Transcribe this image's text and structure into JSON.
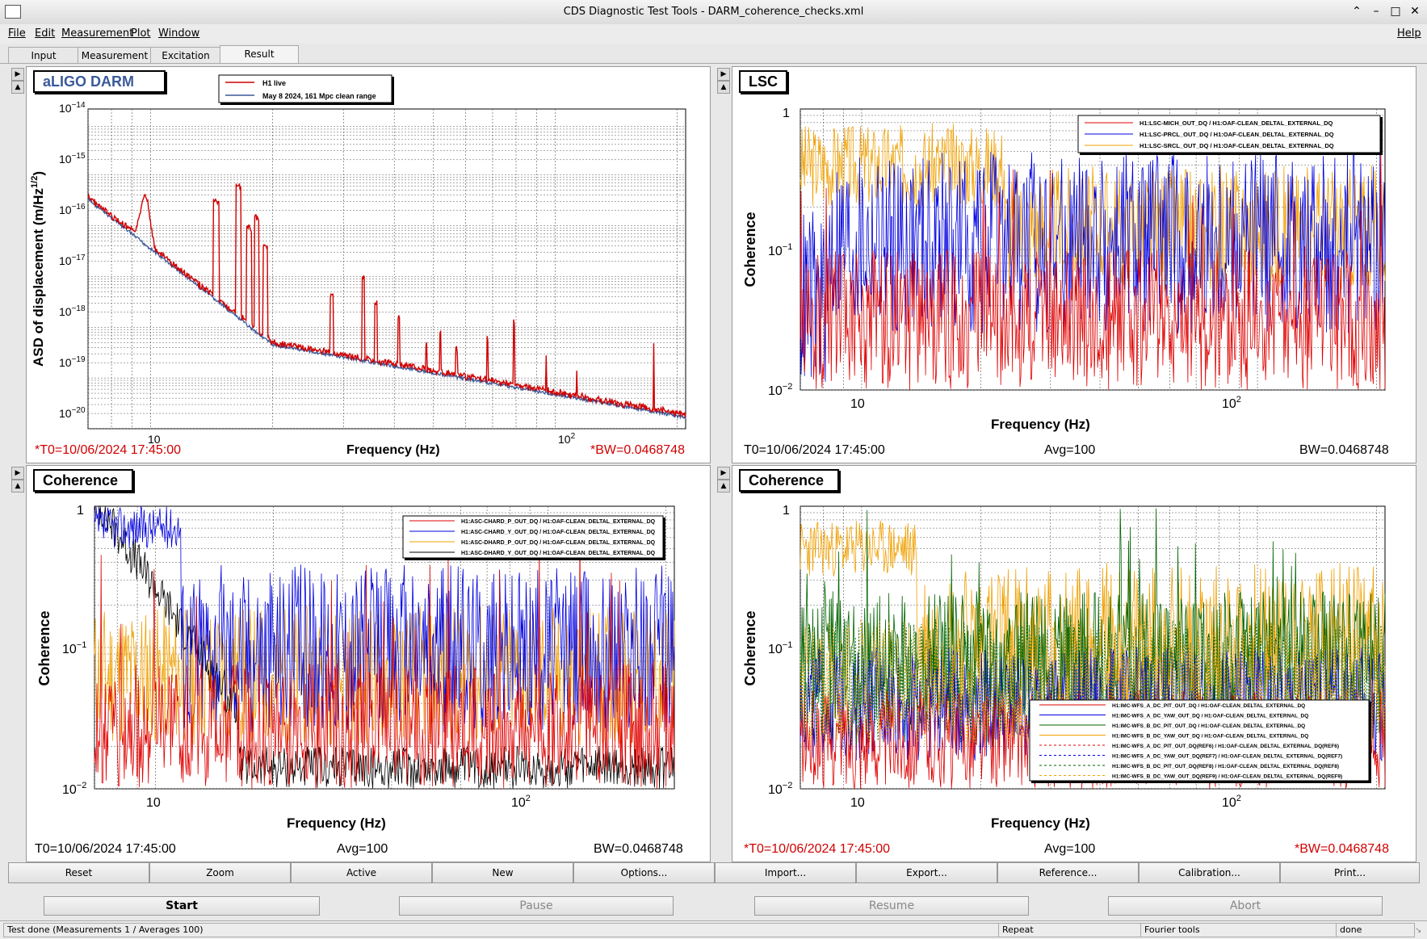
{
  "window": {
    "title": "CDS Diagnostic Test Tools - DARM_coherence_checks.xml"
  },
  "menu": {
    "file": "File",
    "edit": "Edit",
    "measurement": "Measurement",
    "plot": "Plot",
    "window": "Window",
    "help": "Help"
  },
  "tabs": [
    "Input",
    "Measurement",
    "Excitation",
    "Result"
  ],
  "active_tab": "Result",
  "panels": {
    "darm": {
      "label": "aLIGO DARM",
      "t0": "*T0=10/06/2024 17:45:00",
      "bw": "*BW=0.0468748",
      "xlabel": "Frequency (Hz)",
      "ylabel": "ASD of displacement (m/Hz",
      "ylabel_sup": "1/2",
      "ylabel_end": ")",
      "legend": [
        "H1 live",
        "May 8 2024, 161 Mpc clean range"
      ]
    },
    "lsc": {
      "label": "LSC",
      "t0": "T0=10/06/2024 17:45:00",
      "avg": "Avg=100",
      "bw": "BW=0.0468748",
      "xlabel": "Frequency (Hz)",
      "ylabel": "Coherence",
      "legend": [
        "H1:LSC-MICH_OUT_DQ / H1:OAF-CLEAN_DELTAL_EXTERNAL_DQ",
        "H1:LSC-PRCL_OUT_DQ / H1:OAF-CLEAN_DELTAL_EXTERNAL_DQ",
        "H1:LSC-SRCL_OUT_DQ / H1:OAF-CLEAN_DELTAL_EXTERNAL_DQ"
      ]
    },
    "asc": {
      "label": "Coherence",
      "t0": "T0=10/06/2024 17:45:00",
      "avg": "Avg=100",
      "bw": "BW=0.0468748",
      "xlabel": "Frequency (Hz)",
      "ylabel": "Coherence",
      "legend": [
        "H1:ASC-CHARD_P_OUT_DQ / H1:OAF-CLEAN_DELTAL_EXTERNAL_DQ",
        "H1:ASC-CHARD_Y_OUT_DQ / H1:OAF-CLEAN_DELTAL_EXTERNAL_DQ",
        "H1:ASC-DHARD_P_OUT_DQ / H1:OAF-CLEAN_DELTAL_EXTERNAL_DQ",
        "H1:ASC-DHARD_Y_OUT_DQ / H1:OAF-CLEAN_DELTAL_EXTERNAL_DQ"
      ]
    },
    "imc": {
      "label": "Coherence",
      "t0": "*T0=10/06/2024 17:45:00",
      "avg": "Avg=100",
      "bw": "*BW=0.0468748",
      "xlabel": "Frequency (Hz)",
      "ylabel": "Coherence",
      "legend": [
        "H1:IMC-WFS_A_DC_PIT_OUT_DQ / H1:OAF-CLEAN_DELTAL_EXTERNAL_DQ",
        "H1:IMC-WFS_A_DC_YAW_OUT_DQ / H1:OAF-CLEAN_DELTAL_EXTERNAL_DQ",
        "H1:IMC-WFS_B_DC_PIT_OUT_DQ / H1:OAF-CLEAN_DELTAL_EXTERNAL_DQ",
        "H1:IMC-WFS_B_DC_YAW_OUT_DQ / H1:OAF-CLEAN_DELTAL_EXTERNAL_DQ",
        "H1:IMC-WFS_A_DC_PIT_OUT_DQ(REF6) / H1:OAF-CLEAN_DELTAL_EXTERNAL_DQ(REF6)",
        "H1:IMC-WFS_A_DC_YAW_OUT_DQ(REF7) / H1:OAF-CLEAN_DELTAL_EXTERNAL_DQ(REF7)",
        "H1:IMC-WFS_B_DC_PIT_OUT_DQ(REF8) / H1:OAF-CLEAN_DELTAL_EXTERNAL_DQ(REF8)",
        "H1:IMC-WFS_B_DC_YAW_OUT_DQ(REF9) / H1:OAF-CLEAN_DELTAL_EXTERNAL_DQ(REF9)"
      ]
    }
  },
  "ticks": {
    "x_ten": "10",
    "x_hundred_base": "10",
    "x_hundred_exp": "2",
    "coh_one": "1",
    "coh_tenth_base": "10",
    "coh_tenth_exp": "−1",
    "coh_hundredth_base": "10",
    "coh_hundredth_exp": "−2",
    "asd": [
      {
        "base": "10",
        "exp": "−14"
      },
      {
        "base": "10",
        "exp": "−15"
      },
      {
        "base": "10",
        "exp": "−16"
      },
      {
        "base": "10",
        "exp": "−17"
      },
      {
        "base": "10",
        "exp": "−18"
      },
      {
        "base": "10",
        "exp": "−19"
      },
      {
        "base": "10",
        "exp": "−20"
      }
    ]
  },
  "plot_buttons": [
    "Reset",
    "Zoom",
    "Active",
    "New",
    "Options...",
    "Import...",
    "Export...",
    "Reference...",
    "Calibration...",
    "Print..."
  ],
  "control_buttons": {
    "start": "Start",
    "pause": "Pause",
    "resume": "Resume",
    "abort": "Abort"
  },
  "status": {
    "message": "Test done (Measurements 1 / Averages 100)",
    "mode": "Repeat",
    "tool": "Fourier tools",
    "state": "done"
  },
  "colors": {
    "red": "#e00000",
    "blue": "#0000e0",
    "orange": "#f0a000",
    "black": "#000000",
    "green": "#006400",
    "steel": "#3a5a9a",
    "darm_label": "#3a5a9a"
  }
}
